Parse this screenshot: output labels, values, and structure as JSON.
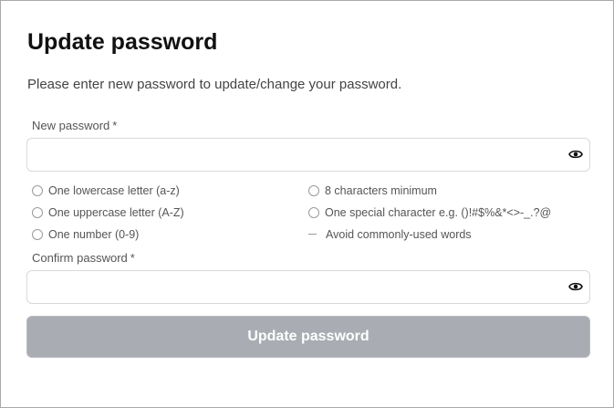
{
  "form": {
    "title": "Update password",
    "subtitle": "Please enter new password to update/change your password.",
    "new_password": {
      "label": "New password",
      "required_mark": "*",
      "value": "",
      "icon": "eye-icon"
    },
    "rules": {
      "left": [
        "One lowercase letter (a-z)",
        "One uppercase letter (A-Z)",
        "One number (0-9)"
      ],
      "right": [
        "8 characters minimum",
        "One special character e.g. ()!#$%&*<>-_.?@",
        "Avoid commonly-used words"
      ]
    },
    "confirm_password": {
      "label": "Confirm password",
      "required_mark": "*",
      "value": "",
      "icon": "eye-icon"
    },
    "submit_label": "Update password"
  },
  "colors": {
    "button_disabled_bg": "#a9adb3",
    "button_text": "#ffffff",
    "border": "#d9d9d9",
    "title": "#111111"
  }
}
